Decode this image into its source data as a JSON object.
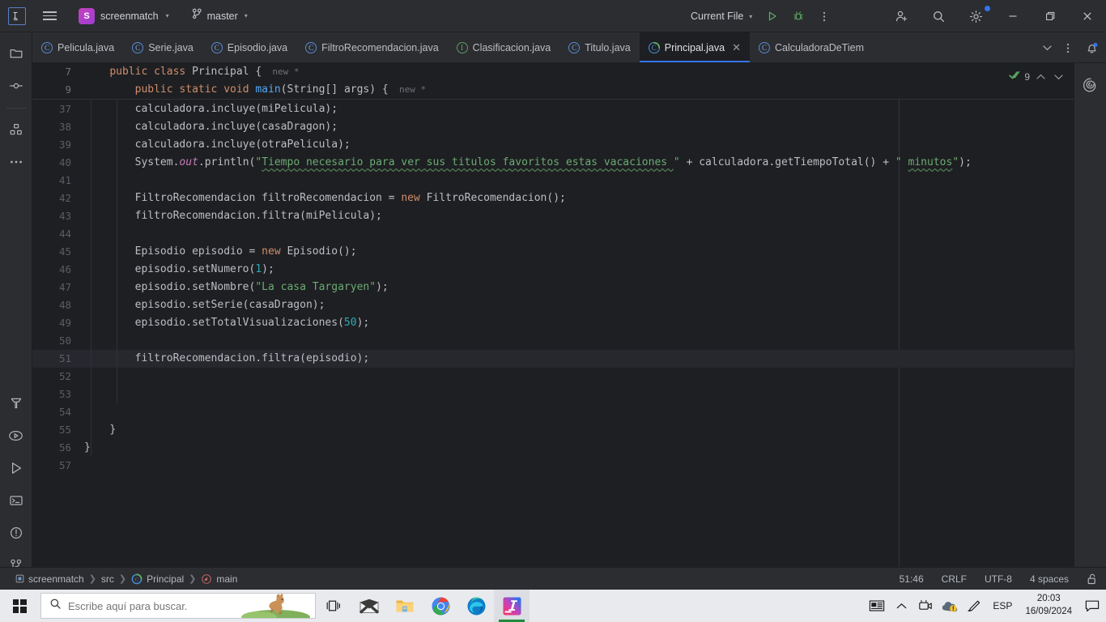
{
  "titlebar": {
    "logo": "IJ",
    "menu_icon": "hamburger-menu-icon",
    "project_badge": "S",
    "project_name": "screenmatch",
    "branch_icon": "git-branch-icon",
    "branch_name": "master",
    "run_config": "Current File",
    "run_icon": "run-icon",
    "debug_icon": "debug-icon",
    "more_icon": "more-vertical-icon",
    "share_icon": "add-user-icon",
    "search_icon": "search-icon",
    "settings_icon": "gear-icon",
    "minimize": "–",
    "maximize": "❐",
    "close": "✕"
  },
  "rail": {
    "items": [
      {
        "name": "project-icon",
        "glyph": "folder"
      },
      {
        "name": "commit-icon",
        "glyph": "commit"
      },
      {
        "name": "structure-icon",
        "glyph": "structure"
      },
      {
        "name": "more-tool-windows-icon",
        "glyph": "ellipsis"
      }
    ],
    "bottom_items": [
      {
        "name": "build-icon",
        "glyph": "hammer"
      },
      {
        "name": "run-anything-icon",
        "glyph": "run-circle"
      },
      {
        "name": "run-tool-icon",
        "glyph": "play"
      },
      {
        "name": "terminal-icon",
        "glyph": "terminal"
      },
      {
        "name": "problems-icon",
        "glyph": "warning-circle"
      },
      {
        "name": "version-control-icon",
        "glyph": "branch"
      }
    ]
  },
  "tabs": [
    {
      "label": "Pelicula.java",
      "kind": "class",
      "active": false,
      "closable": false
    },
    {
      "label": "Serie.java",
      "kind": "class",
      "active": false,
      "closable": false
    },
    {
      "label": "Episodio.java",
      "kind": "class",
      "active": false,
      "closable": false
    },
    {
      "label": "FiltroRecomendacion.java",
      "kind": "class",
      "active": false,
      "closable": false
    },
    {
      "label": "Clasificacion.java",
      "kind": "interface",
      "active": false,
      "closable": false
    },
    {
      "label": "Titulo.java",
      "kind": "class",
      "active": false,
      "closable": false
    },
    {
      "label": "Principal.java",
      "kind": "runnable",
      "active": true,
      "closable": true
    },
    {
      "label": "CalculadoraDeTiem",
      "kind": "class",
      "active": false,
      "closable": false
    }
  ],
  "tabbar_actions": {
    "list_icon": "chevron-down-icon",
    "options_icon": "more-vertical-icon",
    "notifications_icon": "bell-icon"
  },
  "editor": {
    "sticky_lines": [
      {
        "num": "7",
        "indent": 1,
        "hint": "new *",
        "tokens": [
          {
            "t": "public ",
            "c": "kw"
          },
          {
            "t": "class ",
            "c": "kw"
          },
          {
            "t": "Principal {",
            "c": "pl"
          }
        ]
      },
      {
        "num": "9",
        "indent": 2,
        "hint": "new *",
        "tokens": [
          {
            "t": "public ",
            "c": "kw"
          },
          {
            "t": "static ",
            "c": "kw"
          },
          {
            "t": "void ",
            "c": "kw"
          },
          {
            "t": "main",
            "c": "mth"
          },
          {
            "t": "(String[] args) {",
            "c": "pl"
          }
        ]
      }
    ],
    "lines": [
      {
        "num": "37",
        "hl": false,
        "indent": 2,
        "tokens": [
          {
            "t": "calculadora.incluye(miPelicula);",
            "c": "pl"
          }
        ]
      },
      {
        "num": "38",
        "hl": false,
        "indent": 2,
        "tokens": [
          {
            "t": "calculadora.incluye(casaDragon);",
            "c": "pl"
          }
        ]
      },
      {
        "num": "39",
        "hl": false,
        "indent": 2,
        "tokens": [
          {
            "t": "calculadora.incluye(otraPelicula);",
            "c": "pl"
          }
        ]
      },
      {
        "num": "40",
        "hl": false,
        "indent": 2,
        "tokens": [
          {
            "t": "System.",
            "c": "pl"
          },
          {
            "t": "out",
            "c": "fld"
          },
          {
            "t": ".println(",
            "c": "pl"
          },
          {
            "t": "\"",
            "c": "str"
          },
          {
            "t": "Tiempo necesario para ver sus titulos favoritos estas vacaciones ",
            "c": "str typo"
          },
          {
            "t": "\"",
            "c": "str"
          },
          {
            "t": " + calculadora.getTiempoTotal() + ",
            "c": "pl"
          },
          {
            "t": "\" ",
            "c": "str"
          },
          {
            "t": "minutos",
            "c": "str typo"
          },
          {
            "t": "\"",
            "c": "str"
          },
          {
            "t": ");",
            "c": "pl"
          }
        ]
      },
      {
        "num": "41",
        "hl": false,
        "indent": 2,
        "tokens": []
      },
      {
        "num": "42",
        "hl": false,
        "indent": 2,
        "tokens": [
          {
            "t": "FiltroRecomendacion filtroRecomendacion = ",
            "c": "pl"
          },
          {
            "t": "new ",
            "c": "kw"
          },
          {
            "t": "FiltroRecomendacion();",
            "c": "pl"
          }
        ]
      },
      {
        "num": "43",
        "hl": false,
        "indent": 2,
        "tokens": [
          {
            "t": "filtroRecomendacion.filtra(miPelicula);",
            "c": "pl"
          }
        ]
      },
      {
        "num": "44",
        "hl": false,
        "indent": 2,
        "tokens": []
      },
      {
        "num": "45",
        "hl": false,
        "indent": 2,
        "tokens": [
          {
            "t": "Episodio episodio = ",
            "c": "pl"
          },
          {
            "t": "new ",
            "c": "kw"
          },
          {
            "t": "Episodio();",
            "c": "pl"
          }
        ]
      },
      {
        "num": "46",
        "hl": false,
        "indent": 2,
        "tokens": [
          {
            "t": "episodio.setNumero(",
            "c": "pl"
          },
          {
            "t": "1",
            "c": "num"
          },
          {
            "t": ");",
            "c": "pl"
          }
        ]
      },
      {
        "num": "47",
        "hl": false,
        "indent": 2,
        "tokens": [
          {
            "t": "episodio.setNombre(",
            "c": "pl"
          },
          {
            "t": "\"La casa Targaryen\"",
            "c": "str"
          },
          {
            "t": ");",
            "c": "pl"
          }
        ]
      },
      {
        "num": "48",
        "hl": false,
        "indent": 2,
        "tokens": [
          {
            "t": "episodio.setSerie(casaDragon);",
            "c": "pl"
          }
        ]
      },
      {
        "num": "49",
        "hl": false,
        "indent": 2,
        "tokens": [
          {
            "t": "episodio.setTotalVisualizaciones(",
            "c": "pl"
          },
          {
            "t": "50",
            "c": "num"
          },
          {
            "t": ");",
            "c": "pl"
          }
        ]
      },
      {
        "num": "50",
        "hl": false,
        "indent": 2,
        "tokens": []
      },
      {
        "num": "51",
        "hl": true,
        "indent": 2,
        "tokens": [
          {
            "t": "filtroRecomendacion.filtra(episodio);",
            "c": "pl"
          }
        ]
      },
      {
        "num": "52",
        "hl": false,
        "indent": 2,
        "tokens": []
      },
      {
        "num": "53",
        "hl": false,
        "indent": 2,
        "tokens": []
      },
      {
        "num": "54",
        "hl": false,
        "indent": 2,
        "tokens": []
      },
      {
        "num": "55",
        "hl": false,
        "indent": 1,
        "tokens": [
          {
            "t": "}",
            "c": "pl"
          }
        ]
      },
      {
        "num": "56",
        "hl": false,
        "indent": 0,
        "tokens": [
          {
            "t": "}",
            "c": "pl"
          }
        ]
      },
      {
        "num": "57",
        "hl": false,
        "indent": 0,
        "tokens": []
      }
    ],
    "inspection": {
      "status_icon": "checkmark-icon",
      "count": "9",
      "prev_icon": "chevron-up-icon",
      "next_icon": "chevron-down-icon"
    },
    "right_rail": {
      "ai_icon": "ai-assistant-icon"
    }
  },
  "statusbar": {
    "breadcrumb": [
      {
        "label": "screenmatch",
        "icon": "module-icon"
      },
      {
        "label": "src",
        "icon": ""
      },
      {
        "label": "Principal",
        "icon": "runnable-class-icon"
      },
      {
        "label": "main",
        "icon": "method-icon"
      }
    ],
    "caret": "51:46",
    "line_separator": "CRLF",
    "encoding": "UTF-8",
    "indent": "4 spaces",
    "lock_icon": "unlocked-icon"
  },
  "taskbar": {
    "start_icon": "windows-start-icon",
    "search_placeholder": "Escribe aquí para buscar.",
    "search_icon": "search-icon",
    "apps": [
      {
        "name": "task-view-icon",
        "glyph": "taskview"
      },
      {
        "name": "mail-icon",
        "glyph": "mail"
      },
      {
        "name": "file-explorer-icon",
        "glyph": "folder"
      },
      {
        "name": "chrome-icon",
        "glyph": "chrome"
      },
      {
        "name": "edge-icon",
        "glyph": "edge"
      },
      {
        "name": "intellij-idea-icon",
        "glyph": "intellij",
        "active": true
      }
    ],
    "tray": {
      "news_icon": "news-and-interests-icon",
      "expand_icon": "show-hidden-icons-icon",
      "camera_icon": "camera-icon",
      "onedrive_icon": "onedrive-warning-icon",
      "pen_icon": "pen-icon",
      "language": "ESP",
      "time": "20:03",
      "date": "16/09/2024",
      "action_center_icon": "action-center-icon"
    }
  },
  "colors": {
    "accent": "#3574f0",
    "bg_editor": "#1e1f22",
    "bg_chrome": "#2b2d30",
    "keyword": "#cf8e6d",
    "string": "#6aab73",
    "number": "#2aacb8",
    "method": "#56a8f5",
    "field": "#c77dbb"
  }
}
